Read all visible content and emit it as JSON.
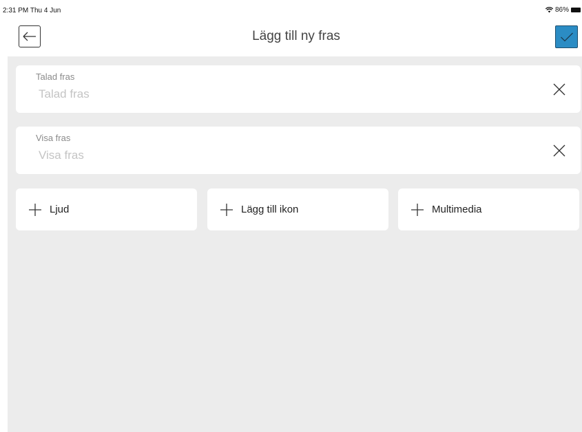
{
  "status_bar": {
    "time": "2:31 PM  Thu 4 Jun",
    "battery": "86%"
  },
  "header": {
    "title": "Lägg till ny fras",
    "back_icon": "arrow-left-icon",
    "confirm_icon": "checkmark-icon",
    "confirm_color": "#2b8cc4"
  },
  "fields": [
    {
      "label": "Talad fras",
      "placeholder": "Talad fras",
      "value": ""
    },
    {
      "label": "Visa fras",
      "placeholder": "Visa fras",
      "value": ""
    }
  ],
  "actions": [
    {
      "label": "Ljud",
      "icon": "plus-icon"
    },
    {
      "label": "Lägg till ikon",
      "icon": "plus-icon"
    },
    {
      "label": "Multimedia",
      "icon": "plus-icon"
    }
  ],
  "colors": {
    "background": "#ececec",
    "card": "#ffffff"
  }
}
